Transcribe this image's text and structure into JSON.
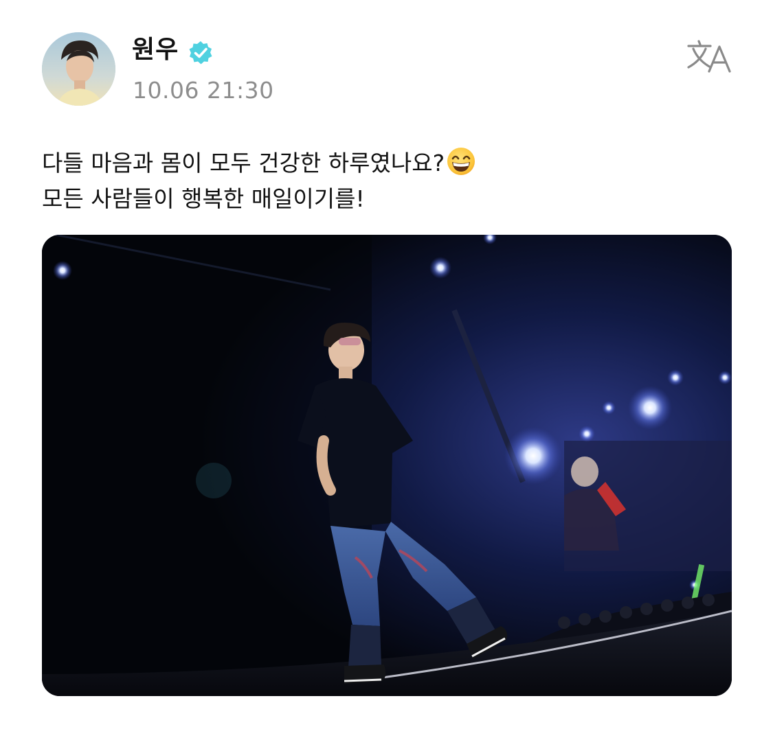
{
  "author": {
    "name": "원우",
    "verified": true,
    "timestamp": "10.06 21:30",
    "avatar_alt": "profile photo"
  },
  "post": {
    "lines": [
      "다들 마음과 몸이 모두 건강한 하루였나요?",
      "모든 사람들이 행복한 매일이기를!"
    ],
    "emoji": "grinning-face-with-smiling-eyes"
  },
  "icons": {
    "verified": "verified-check-icon",
    "translate": "translate-icon"
  },
  "colors": {
    "verified": "#4fd1e0",
    "timestamp": "#8d8d8d",
    "text": "#111111"
  }
}
